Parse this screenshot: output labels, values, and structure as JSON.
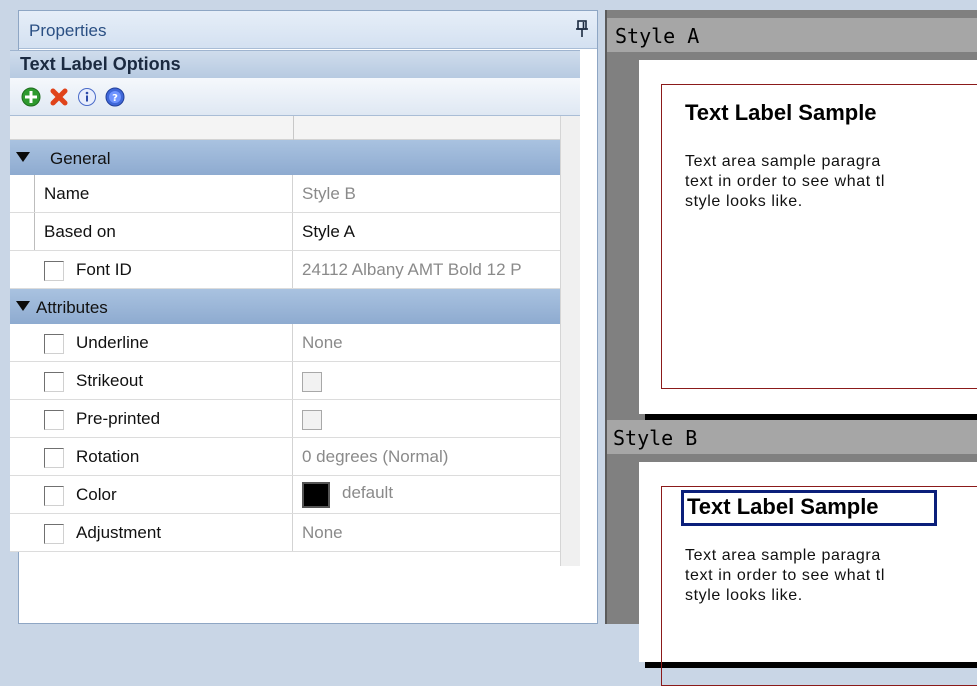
{
  "panel": {
    "title": "Properties",
    "options_title": "Text Label Options"
  },
  "toolbar": {
    "icons": [
      "add-icon",
      "delete-icon",
      "info-icon",
      "help-icon"
    ]
  },
  "categories": {
    "general": "General",
    "attributes": "Attributes"
  },
  "general_rows": [
    {
      "name": "Name",
      "value": "Style B"
    },
    {
      "name": "Based on",
      "value": "Style A"
    },
    {
      "name": "Font ID",
      "value": "24112 Albany AMT Bold 12 P"
    }
  ],
  "attribute_rows": [
    {
      "name": "Underline",
      "value": "None"
    },
    {
      "name": "Strikeout",
      "value": ""
    },
    {
      "name": "Pre-printed",
      "value": ""
    },
    {
      "name": "Rotation",
      "value": "0 degrees (Normal)"
    },
    {
      "name": "Color",
      "value": "default"
    },
    {
      "name": "Adjustment",
      "value": "None"
    }
  ],
  "preview": {
    "style_a": {
      "label": "Style A",
      "title": "Text Label Sample",
      "body": "Text area sample paragra\ntext in order to see what tl\nstyle looks like."
    },
    "style_b": {
      "label": "Style B",
      "title": "Text Label Sample",
      "body": "Text area sample paragra\ntext in order to see what tl\nstyle looks like."
    }
  },
  "colors": {
    "category_band": "#9bb6d8",
    "frame_border": "#8b1a1a",
    "selection": "#0b1f7a"
  }
}
